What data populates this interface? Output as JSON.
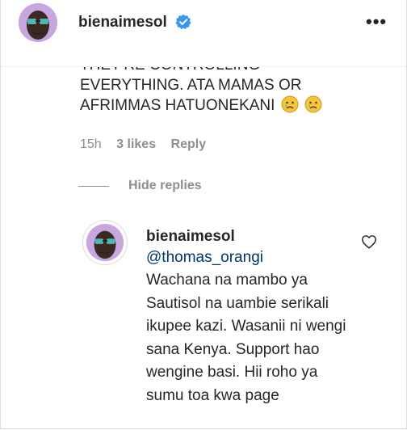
{
  "header": {
    "username": "bienaimesol",
    "more_label": "•••"
  },
  "comment": {
    "text_line1": "THEY'RE CONTROLLING",
    "text_line2": "EVERYTHING. ATA MAMAS OR",
    "text_line3": "AFRIMMAS HATUONEKANI",
    "emojis": [
      "sad-face-icon",
      "sad-face-icon"
    ],
    "time": "15h",
    "likes": "3 likes",
    "reply_label": "Reply"
  },
  "hide_replies_label": "Hide replies",
  "reply": {
    "username": "bienaimesol",
    "mention": "@thomas_orangi",
    "text": "Wachana na mambo ya Sautisol na uambie serikali ikupee kazi. Wasanii ni wengi sana Kenya. Support hao wengine basi. Hii roho ya sumu toa kwa page"
  },
  "colors": {
    "verified_blue": "#3897f0",
    "mention_blue": "#00376b",
    "muted": "#8e8e8e",
    "avatar_bg": "#c8a6e0"
  }
}
